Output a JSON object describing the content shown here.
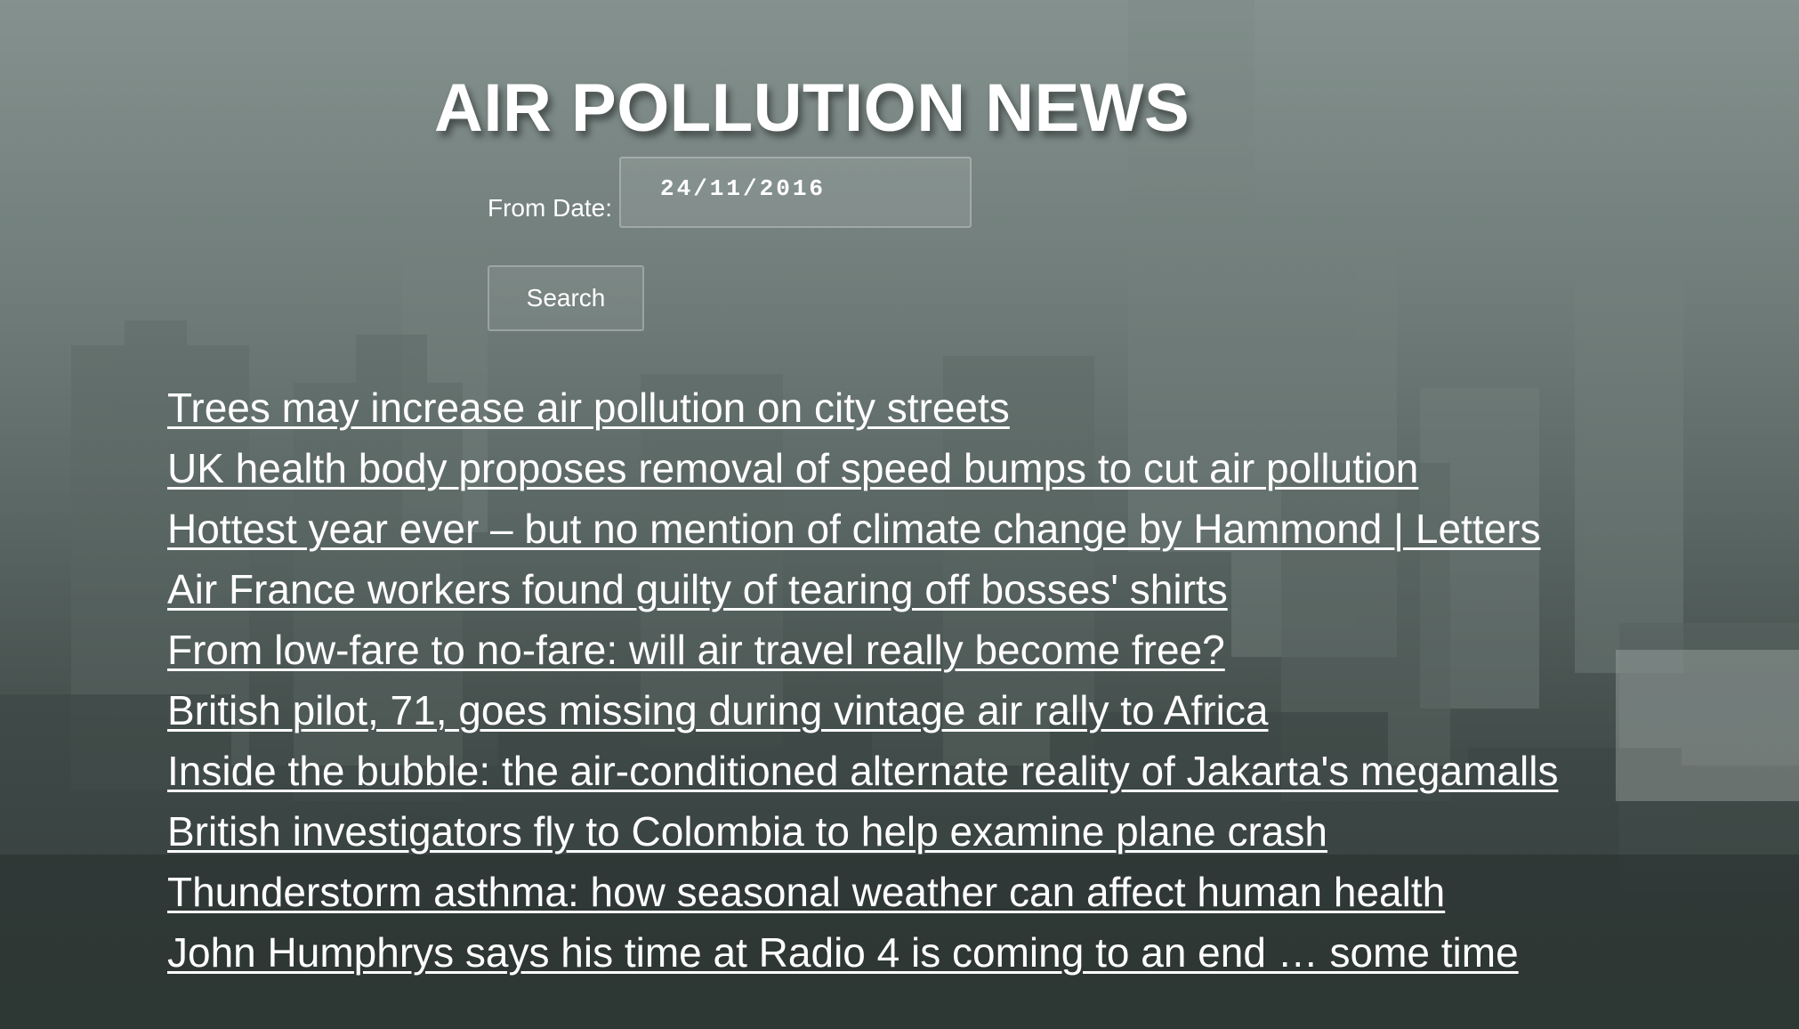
{
  "page": {
    "title": "AIR POLLUTION NEWS"
  },
  "search_form": {
    "from_date_label": "From Date:",
    "from_date_value": "24/11/2016",
    "search_button_label": "Search"
  },
  "news": {
    "items": [
      {
        "title": "Trees may increase air pollution on city streets"
      },
      {
        "title": "UK health body proposes removal of speed bumps to cut air pollution"
      },
      {
        "title": "Hottest year ever – but no mention of climate change by Hammond | Letters"
      },
      {
        "title": "Air France workers found guilty of tearing off bosses' shirts"
      },
      {
        "title": "From low-fare to no-fare: will air travel really become free?"
      },
      {
        "title": "British pilot, 71, goes missing during vintage air rally to Africa"
      },
      {
        "title": "Inside the bubble: the air-conditioned alternate reality of Jakarta's megamalls"
      },
      {
        "title": "British investigators fly to Colombia to help examine plane crash"
      },
      {
        "title": "Thunderstorm asthma: how seasonal weather can affect human health"
      },
      {
        "title": "John Humphrys says his time at Radio 4 is coming to an end … some time"
      }
    ]
  },
  "colors": {
    "text": "#ffffff",
    "haze_top": "#7d8a87",
    "haze_bottom": "#2c3432"
  }
}
